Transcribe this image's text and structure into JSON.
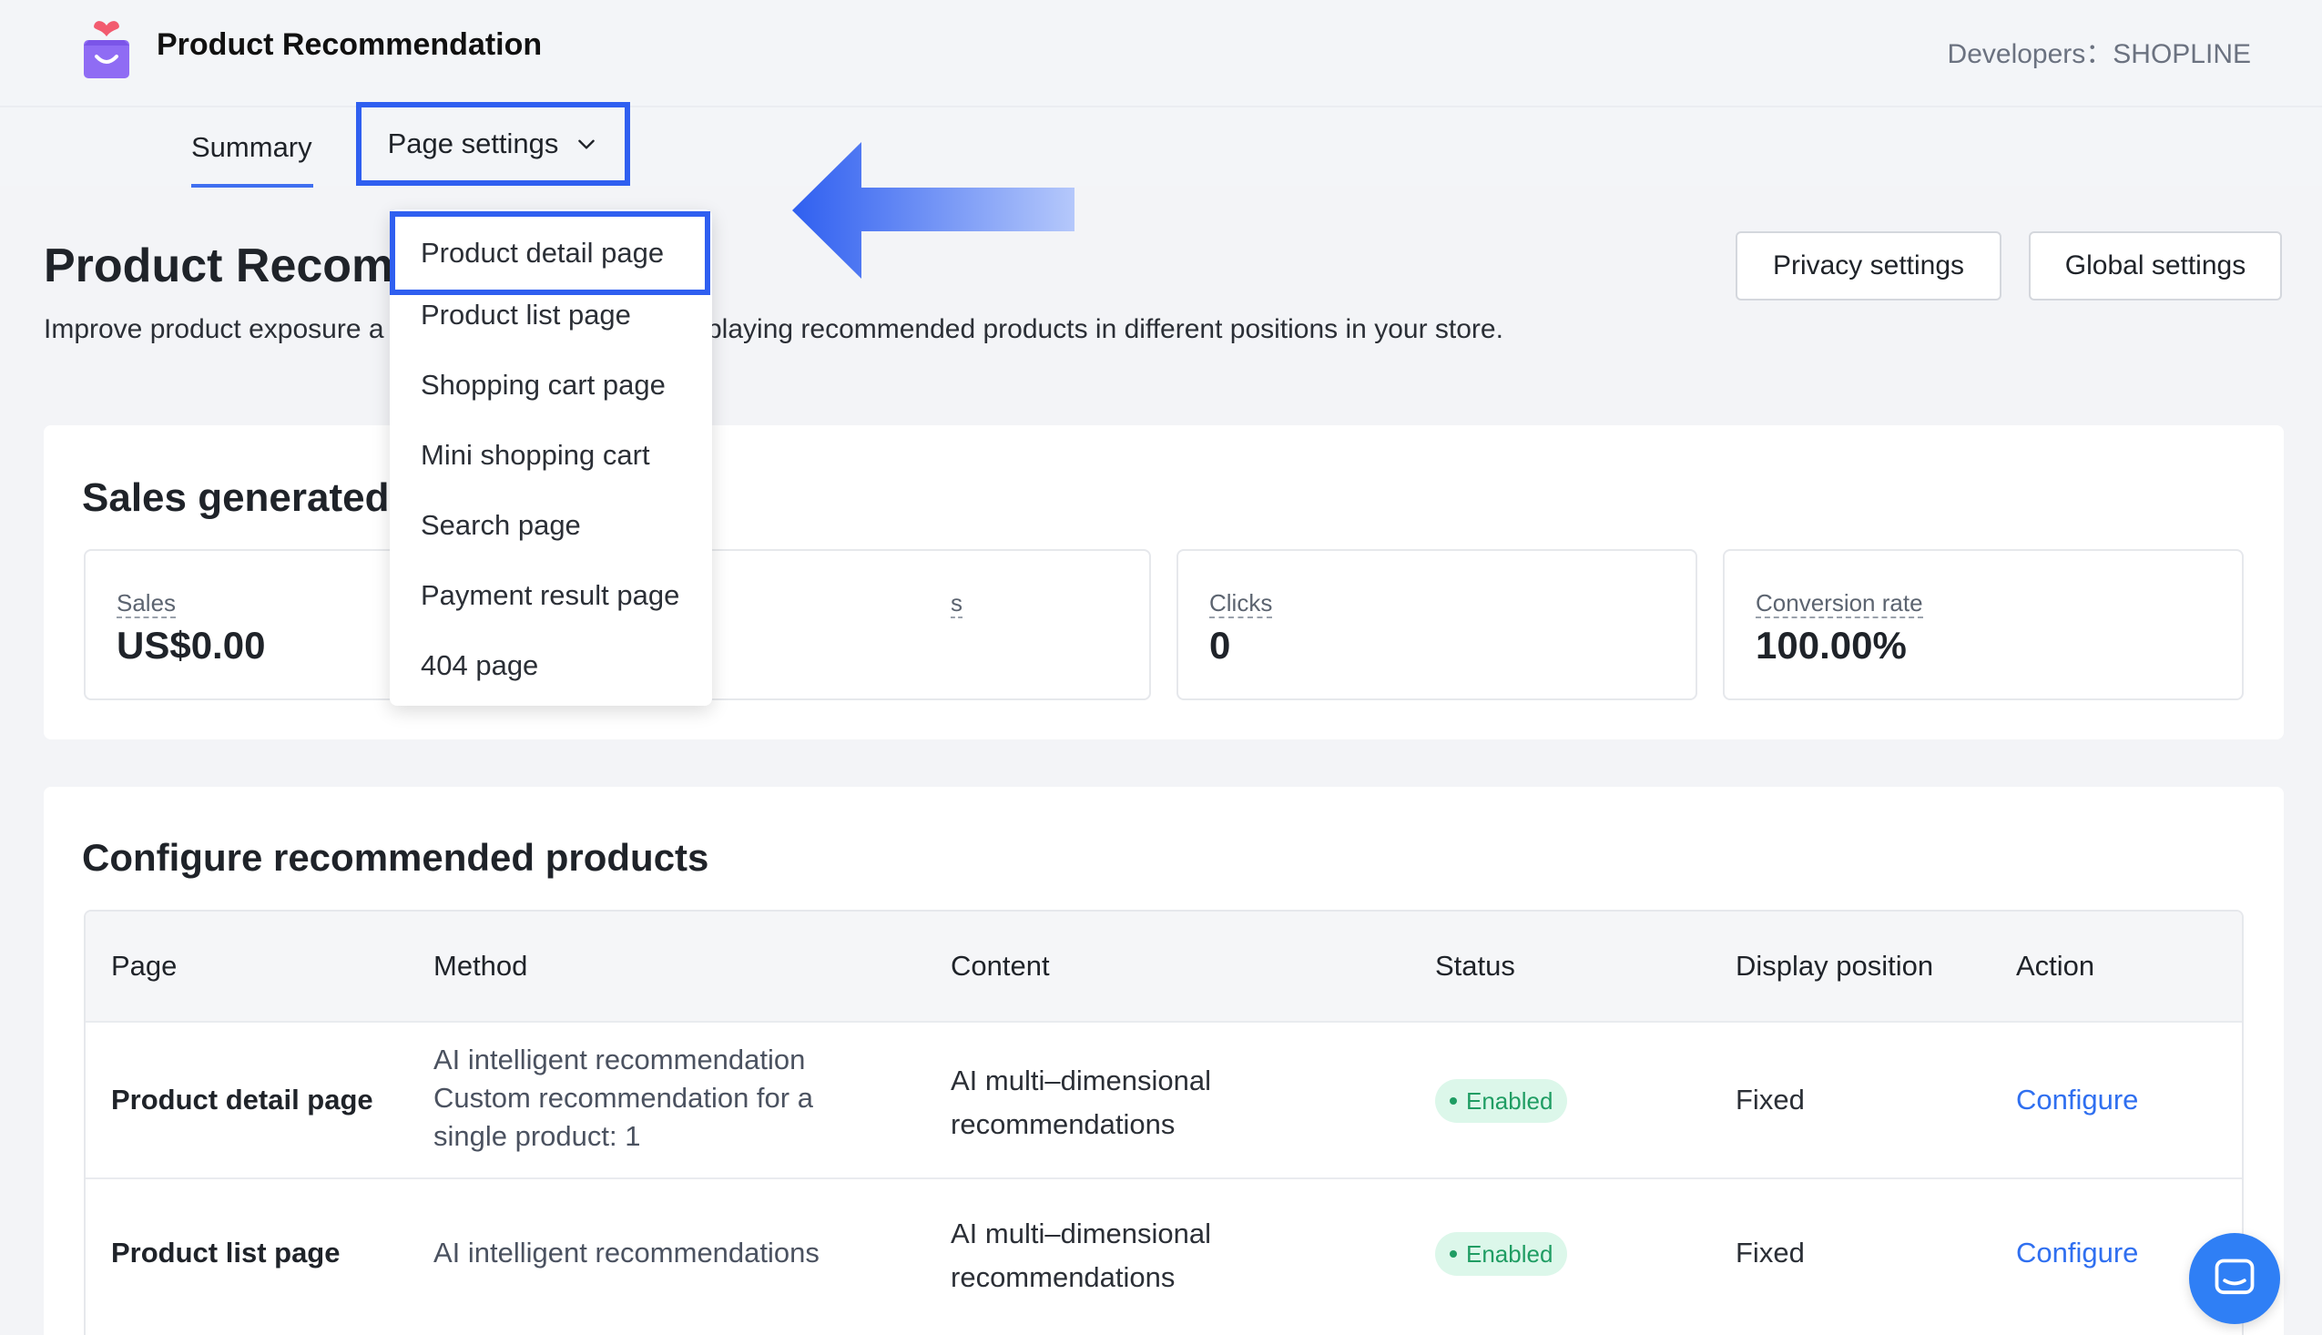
{
  "header": {
    "app_title": "Product Recommendation",
    "developers": "Developers：SHOPLINE",
    "logo_icon": "shopping-bag-heart-icon"
  },
  "tabs": {
    "summary": "Summary",
    "page_settings": "Page settings"
  },
  "dropdown": {
    "items": [
      "Product detail page",
      "Product list page",
      "Shopping cart page",
      "Mini shopping cart",
      "Search page",
      "Payment result page",
      "404 page"
    ]
  },
  "page": {
    "title": "Product Recom",
    "subtitle_left": "Improve product exposure a",
    "subtitle_right": "playing recommended products in different positions in your store.",
    "privacy_button": "Privacy settings",
    "global_button": "Global settings"
  },
  "sales": {
    "heading": "Sales generated",
    "stats": [
      {
        "label": "Sales",
        "value": "US$0.00"
      },
      {
        "label": "s",
        "value": ""
      },
      {
        "label": "Clicks",
        "value": "0"
      },
      {
        "label": "Conversion rate",
        "value": "100.00%"
      }
    ]
  },
  "config": {
    "heading": "Configure recommended products",
    "columns": [
      "Page",
      "Method",
      "Content",
      "Status",
      "Display position",
      "Action"
    ],
    "rows": [
      {
        "page": "Product detail page",
        "method": [
          "AI intelligent recommendation",
          "Custom recommendation for a",
          "single product: 1"
        ],
        "content": [
          "AI multi–dimensional",
          "recommendations"
        ],
        "status": "Enabled",
        "position": "Fixed",
        "action": "Configure"
      },
      {
        "page": "Product list page",
        "method": [
          "AI intelligent recommendations"
        ],
        "content": [
          "AI multi–dimensional",
          "recommendations"
        ],
        "status": "Enabled",
        "position": "Fixed",
        "action": "Configure"
      }
    ]
  },
  "colors": {
    "accent": "#2f5ff0",
    "link": "#2f6ff0",
    "enabled_bg": "#dcf7ea",
    "enabled_text": "#1f9d63"
  },
  "chat_icon": "chat-bubble-icon"
}
